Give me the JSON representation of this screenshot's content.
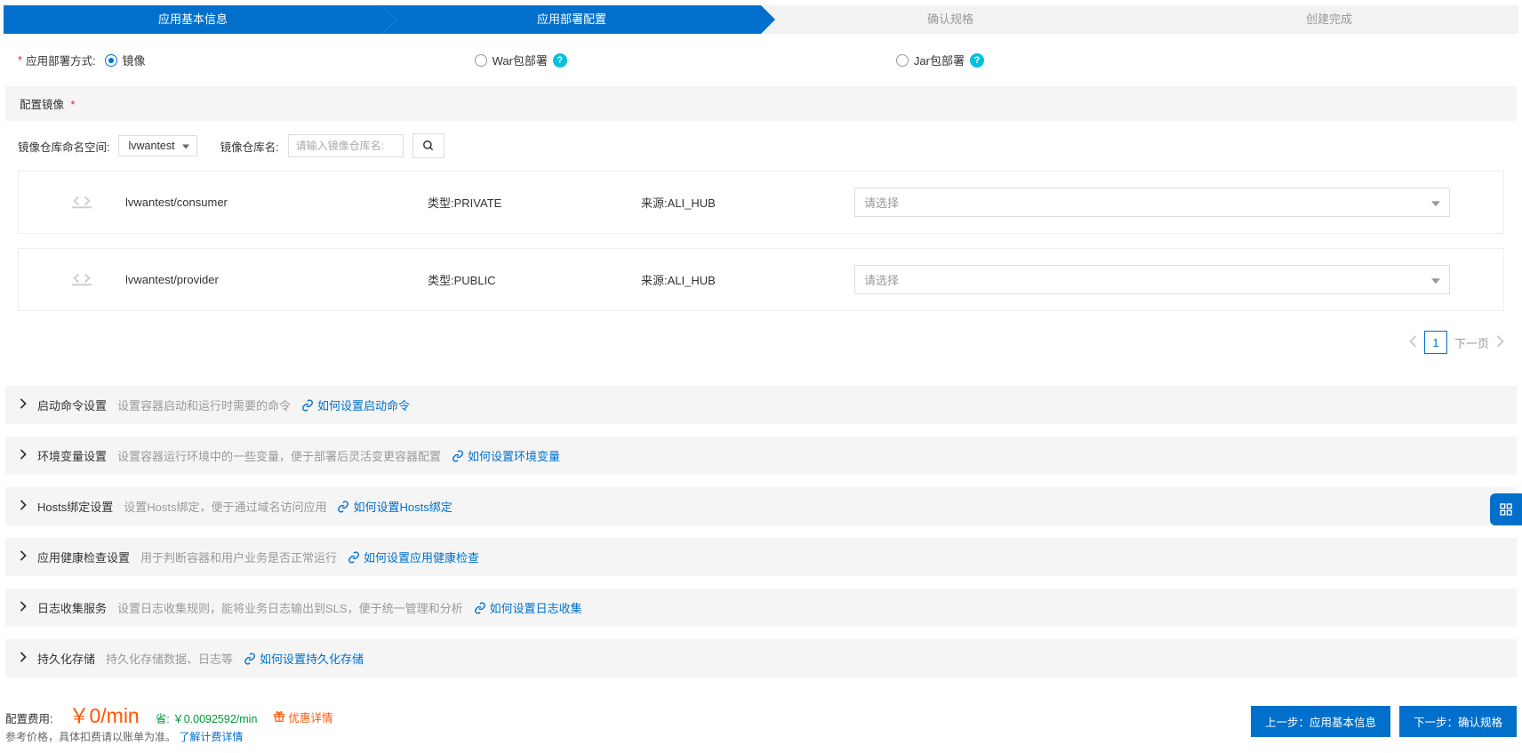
{
  "wizard": {
    "steps": [
      "应用基本信息",
      "应用部署配置",
      "确认规格",
      "创建完成"
    ]
  },
  "deploy": {
    "label": "应用部署方式:",
    "options": [
      "镜像",
      "War包部署",
      "Jar包部署"
    ]
  },
  "imageSection": {
    "title": "配置镜像",
    "nsLabel": "镜像仓库命名空间:",
    "nsValue": "lvwantest",
    "repoLabel": "镜像仓库名:",
    "repoPlaceholder": "请输入镜像仓库名:",
    "rows": [
      {
        "name": "lvwantest/consumer",
        "type": "类型:PRIVATE",
        "source": "来源:ALI_HUB",
        "select": "请选择"
      },
      {
        "name": "lvwantest/provider",
        "type": "类型:PUBLIC",
        "source": "来源:ALI_HUB",
        "select": "请选择"
      }
    ],
    "pagination": {
      "page": "1",
      "next": "下一页"
    }
  },
  "settings": [
    {
      "title": "启动命令设置",
      "desc": "设置容器启动和运行时需要的命令",
      "link": "如何设置启动命令"
    },
    {
      "title": "环境变量设置",
      "desc": "设置容器运行环境中的一些变量，便于部署后灵活变更容器配置",
      "link": "如何设置环境变量"
    },
    {
      "title": "Hosts绑定设置",
      "desc": "设置Hosts绑定，便于通过域名访问应用",
      "link": "如何设置Hosts绑定"
    },
    {
      "title": "应用健康检查设置",
      "desc": "用于判断容器和用户业务是否正常运行",
      "link": "如何设置应用健康检查"
    },
    {
      "title": "日志收集服务",
      "desc": "设置日志收集规则，能将业务日志输出到SLS，便于统一管理和分析",
      "link": "如何设置日志收集"
    },
    {
      "title": "持久化存储",
      "desc": "持久化存储数据、日志等",
      "link": "如何设置持久化存储"
    }
  ],
  "footer": {
    "costLabel": "配置费用:",
    "costValue": "￥0/min",
    "saveLabel": "省:",
    "saveValue": "￥0.0092592/min",
    "promo": "优惠详情",
    "note": "参考价格，具体扣费请以账单为准。",
    "noteLink": "了解计费详情",
    "prev": "上一步：应用基本信息",
    "next": "下一步：确认规格"
  }
}
